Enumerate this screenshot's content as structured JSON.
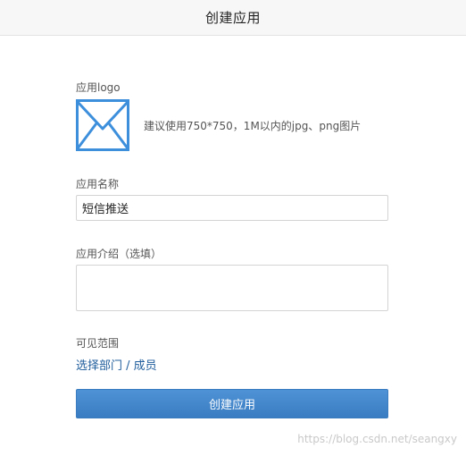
{
  "header": {
    "title": "创建应用"
  },
  "form": {
    "logo_label": "应用logo",
    "logo_icon": "envelope-icon",
    "logo_hint": "建议使用750*750，1M以内的jpg、png图片",
    "name_label": "应用名称",
    "name_value": "短信推送",
    "desc_label": "应用介绍（选填）",
    "desc_value": "",
    "scope_label": "可见范围",
    "scope_dept": "选择部门",
    "scope_sep": " / ",
    "scope_member": "成员",
    "submit_label": "创建应用"
  },
  "watermark": "https://blog.csdn.net/seangxy",
  "colors": {
    "header_bg": "#f7f7f7",
    "link": "#1f5d9c",
    "primary": "#3a7cc1",
    "envelope": "#3d8fdc"
  }
}
